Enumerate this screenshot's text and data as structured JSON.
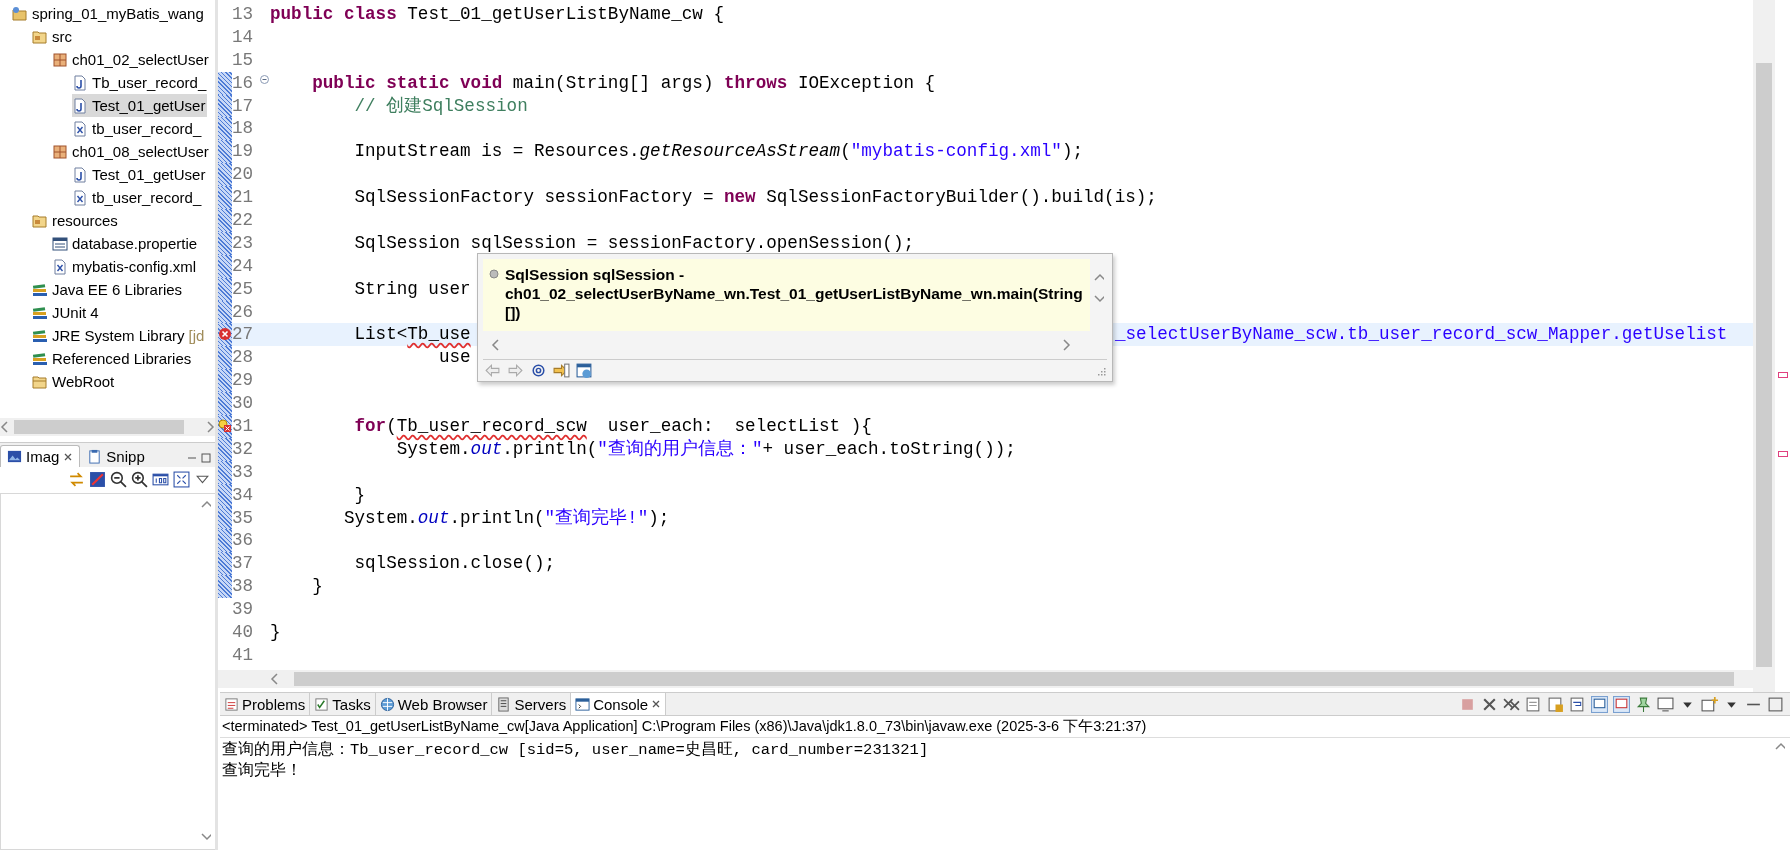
{
  "explorer": {
    "items": [
      {
        "label": "spring_01_myBatis_wang",
        "kind": "project",
        "selected": false,
        "children": [
          {
            "label": "src",
            "kind": "source-folder",
            "selected": false,
            "children": [
              {
                "label": "ch01_02_selectUser",
                "kind": "package",
                "selected": false,
                "children": [
                  {
                    "label": "Tb_user_record_",
                    "kind": "java",
                    "selected": false
                  },
                  {
                    "label": "Test_01_getUser",
                    "kind": "java",
                    "selected": true
                  },
                  {
                    "label": "tb_user_record_",
                    "kind": "xml",
                    "selected": false
                  }
                ]
              },
              {
                "label": "ch01_08_selectUser",
                "kind": "package",
                "selected": false,
                "children": [
                  {
                    "label": "Test_01_getUser",
                    "kind": "java",
                    "selected": false
                  },
                  {
                    "label": "tb_user_record_",
                    "kind": "xml",
                    "selected": false
                  }
                ]
              }
            ]
          },
          {
            "label": "resources",
            "kind": "source-folder",
            "selected": false,
            "children": [
              {
                "label": "database.propertie",
                "kind": "properties",
                "selected": false
              },
              {
                "label": "mybatis-config.xml",
                "kind": "xml",
                "selected": false
              }
            ]
          },
          {
            "label": "Java EE 6 Libraries",
            "kind": "library",
            "selected": false
          },
          {
            "label": "JUnit 4",
            "kind": "library",
            "selected": false
          },
          {
            "label": "JRE System Library",
            "decoration": "[jd",
            "kind": "library",
            "selected": false
          },
          {
            "label": "Referenced Libraries",
            "kind": "library",
            "selected": false
          },
          {
            "label": "WebRoot",
            "kind": "folder",
            "selected": false
          }
        ]
      }
    ]
  },
  "side_views": {
    "tabs": [
      {
        "label": "Imag",
        "selected": true
      },
      {
        "label": "Snipp",
        "selected": false
      }
    ]
  },
  "editor": {
    "lines": [
      {
        "number": "13",
        "changed": false,
        "current": false,
        "segments": [
          {
            "kind": "kw",
            "text": "public class"
          },
          {
            "kind": "plain",
            "text": " Test_01_getUserListByName_cw {"
          }
        ]
      },
      {
        "number": "14",
        "changed": false,
        "current": false
      },
      {
        "number": "15",
        "changed": false,
        "current": false
      },
      {
        "number": "16",
        "changed": true,
        "current": false,
        "kind": "fold",
        "segments": [
          {
            "kind": "kw",
            "text": "    public static void"
          },
          {
            "kind": "plain",
            "text": " main(String[] args) "
          },
          {
            "kind": "kw",
            "text": "throws"
          },
          {
            "kind": "plain",
            "text": " IOException {"
          }
        ]
      },
      {
        "number": "17",
        "changed": true,
        "current": false,
        "segments": [
          {
            "kind": "comment",
            "text": "        // 创建SqlSession"
          }
        ]
      },
      {
        "number": "18",
        "changed": true,
        "current": false
      },
      {
        "number": "19",
        "changed": true,
        "current": false,
        "segments": [
          {
            "kind": "plain",
            "text": "        InputStream is = Resources."
          },
          {
            "kind": "static",
            "text": "getResourceAsStream"
          },
          {
            "kind": "plain",
            "text": "("
          },
          {
            "kind": "str",
            "text": "\"mybatis-config.xml\""
          },
          {
            "kind": "plain",
            "text": ");"
          }
        ]
      },
      {
        "number": "20",
        "changed": true,
        "current": false
      },
      {
        "number": "21",
        "changed": true,
        "current": false,
        "segments": [
          {
            "kind": "plain",
            "text": "        SqlSessionFactory sessionFactory = "
          },
          {
            "kind": "kw",
            "text": "new"
          },
          {
            "kind": "plain",
            "text": " SqlSessionFactoryBuilder().build(is);"
          }
        ]
      },
      {
        "number": "22",
        "changed": true,
        "current": false
      },
      {
        "number": "23",
        "changed": true,
        "current": false,
        "segments": [
          {
            "kind": "plain",
            "text": "        SqlSession sqlSession = sessionFactory.openSession();"
          }
        ]
      },
      {
        "number": "24",
        "changed": true,
        "current": false
      },
      {
        "number": "25",
        "changed": true,
        "current": false,
        "segments": [
          {
            "kind": "plain",
            "text": "        String user"
          }
        ]
      },
      {
        "number": "26",
        "changed": true,
        "current": false
      },
      {
        "number": "27",
        "changed": true,
        "current": true,
        "kind": "error",
        "segments": [
          {
            "kind": "plain",
            "text": "        List<"
          },
          {
            "kind": "error",
            "text": "Tb_use"
          }
        ],
        "right_segments": [
          {
            "kind": "str",
            "text": "_selectUserByName_scw.tb_user_record_scw_Mapper.getUselist"
          }
        ]
      },
      {
        "number": "28",
        "changed": true,
        "current": false,
        "segments": [
          {
            "kind": "plain",
            "text": "                use"
          }
        ]
      },
      {
        "number": "29",
        "changed": true,
        "current": false
      },
      {
        "number": "30",
        "changed": true,
        "current": false
      },
      {
        "number": "31",
        "changed": true,
        "current": false,
        "kind": "warning-error",
        "segments": [
          {
            "kind": "kw",
            "text": "        for"
          },
          {
            "kind": "plain",
            "text": "("
          },
          {
            "kind": "error",
            "text": "Tb_user_record_scw"
          },
          {
            "kind": "plain",
            "text": "  user_each:  selectList ){"
          }
        ]
      },
      {
        "number": "32",
        "changed": true,
        "current": false,
        "segments": [
          {
            "kind": "plain",
            "text": "            System."
          },
          {
            "kind": "field",
            "text": "out"
          },
          {
            "kind": "plain",
            "text": ".println("
          },
          {
            "kind": "str",
            "text": "\"查询的用户信息：\""
          },
          {
            "kind": "plain",
            "text": "+ user_each.toString());"
          }
        ]
      },
      {
        "number": "33",
        "changed": true,
        "current": false
      },
      {
        "number": "34",
        "changed": true,
        "current": false,
        "segments": [
          {
            "kind": "plain",
            "text": "        }"
          }
        ]
      },
      {
        "number": "35",
        "changed": true,
        "current": false,
        "segments": [
          {
            "kind": "plain",
            "text": "       System."
          },
          {
            "kind": "field",
            "text": "out"
          },
          {
            "kind": "plain",
            "text": ".println("
          },
          {
            "kind": "str",
            "text": "\"查询完毕!\""
          },
          {
            "kind": "plain",
            "text": ");"
          }
        ]
      },
      {
        "number": "36",
        "changed": true,
        "current": false
      },
      {
        "number": "37",
        "changed": true,
        "current": false,
        "segments": [
          {
            "kind": "plain",
            "text": "        sqlSession.close();"
          }
        ]
      },
      {
        "number": "38",
        "changed": true,
        "current": false,
        "segments": [
          {
            "kind": "plain",
            "text": "    }"
          }
        ]
      },
      {
        "number": "39",
        "changed": false,
        "current": false
      },
      {
        "number": "40",
        "changed": false,
        "current": false,
        "segments": [
          {
            "kind": "plain",
            "text": "}"
          }
        ]
      },
      {
        "number": "41",
        "changed": false,
        "current": false
      }
    ],
    "hover": {
      "text": "SqlSession sqlSession - ch01_02_selectUserByName_wn.Test_01_getUserListByName_wn.main(String[])"
    }
  },
  "bottom_panel": {
    "tabs": [
      {
        "label": "Problems",
        "kind": "problems",
        "selected": false
      },
      {
        "label": "Tasks",
        "kind": "tasks",
        "selected": false
      },
      {
        "label": "Web Browser",
        "kind": "globe",
        "selected": false
      },
      {
        "label": "Servers",
        "kind": "servers",
        "selected": false
      },
      {
        "label": "Console",
        "kind": "console",
        "selected": true
      }
    ],
    "console": {
      "header": "<terminated> Test_01_getUserListByName_cw[Java Application] C:\\Program Files (x86)\\Java\\jdk1.8.0_73\\bin\\javaw.exe (2025-3-6 下午3:21:37)",
      "output": [
        "查询的用户信息：Tb_user_record_cw [sid=5, user_name=史昌旺, card_number=231321]",
        "查询完毕！"
      ]
    }
  }
}
